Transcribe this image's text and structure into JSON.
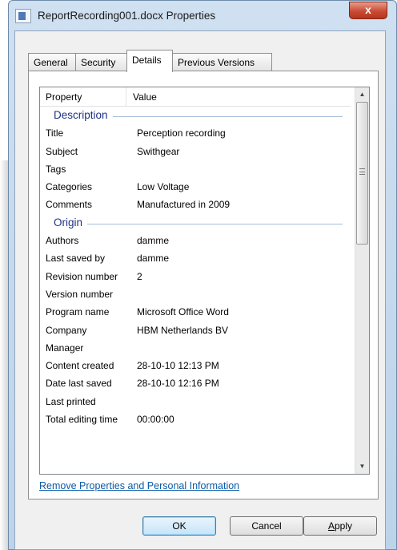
{
  "window": {
    "title": "ReportRecording001.docx Properties",
    "close_glyph": "x"
  },
  "tabs": [
    {
      "label": "General",
      "active": false
    },
    {
      "label": "Security",
      "active": false
    },
    {
      "label": "Details",
      "active": true
    },
    {
      "label": "Previous Versions",
      "active": false
    }
  ],
  "list": {
    "columns": [
      "Property",
      "Value"
    ],
    "groups": [
      {
        "name": "Description",
        "rows": [
          {
            "property": "Title",
            "value": "Perception recording"
          },
          {
            "property": "Subject",
            "value": "Swithgear"
          },
          {
            "property": "Tags",
            "value": ""
          },
          {
            "property": "Categories",
            "value": "Low Voltage"
          },
          {
            "property": "Comments",
            "value": "Manufactured in 2009"
          }
        ]
      },
      {
        "name": "Origin",
        "rows": [
          {
            "property": "Authors",
            "value": "damme"
          },
          {
            "property": "Last saved by",
            "value": "damme"
          },
          {
            "property": "Revision number",
            "value": "2"
          },
          {
            "property": "Version number",
            "value": ""
          },
          {
            "property": "Program name",
            "value": "Microsoft Office Word"
          },
          {
            "property": "Company",
            "value": "HBM Netherlands BV"
          },
          {
            "property": "Manager",
            "value": ""
          },
          {
            "property": "Content created",
            "value": "28-10-10 12:13 PM"
          },
          {
            "property": "Date last saved",
            "value": "28-10-10 12:16 PM"
          },
          {
            "property": "Last printed",
            "value": ""
          },
          {
            "property": "Total editing time",
            "value": "00:00:00"
          }
        ]
      }
    ]
  },
  "remove_link": "Remove Properties and Personal Information",
  "buttons": {
    "ok": "OK",
    "cancel": "Cancel",
    "apply_prefix": "",
    "apply_mnemonic": "A",
    "apply_rest": "pply"
  },
  "icons": {
    "title_icon": "document-properties-icon",
    "scroll_up": "▲",
    "scroll_down": "▼"
  }
}
